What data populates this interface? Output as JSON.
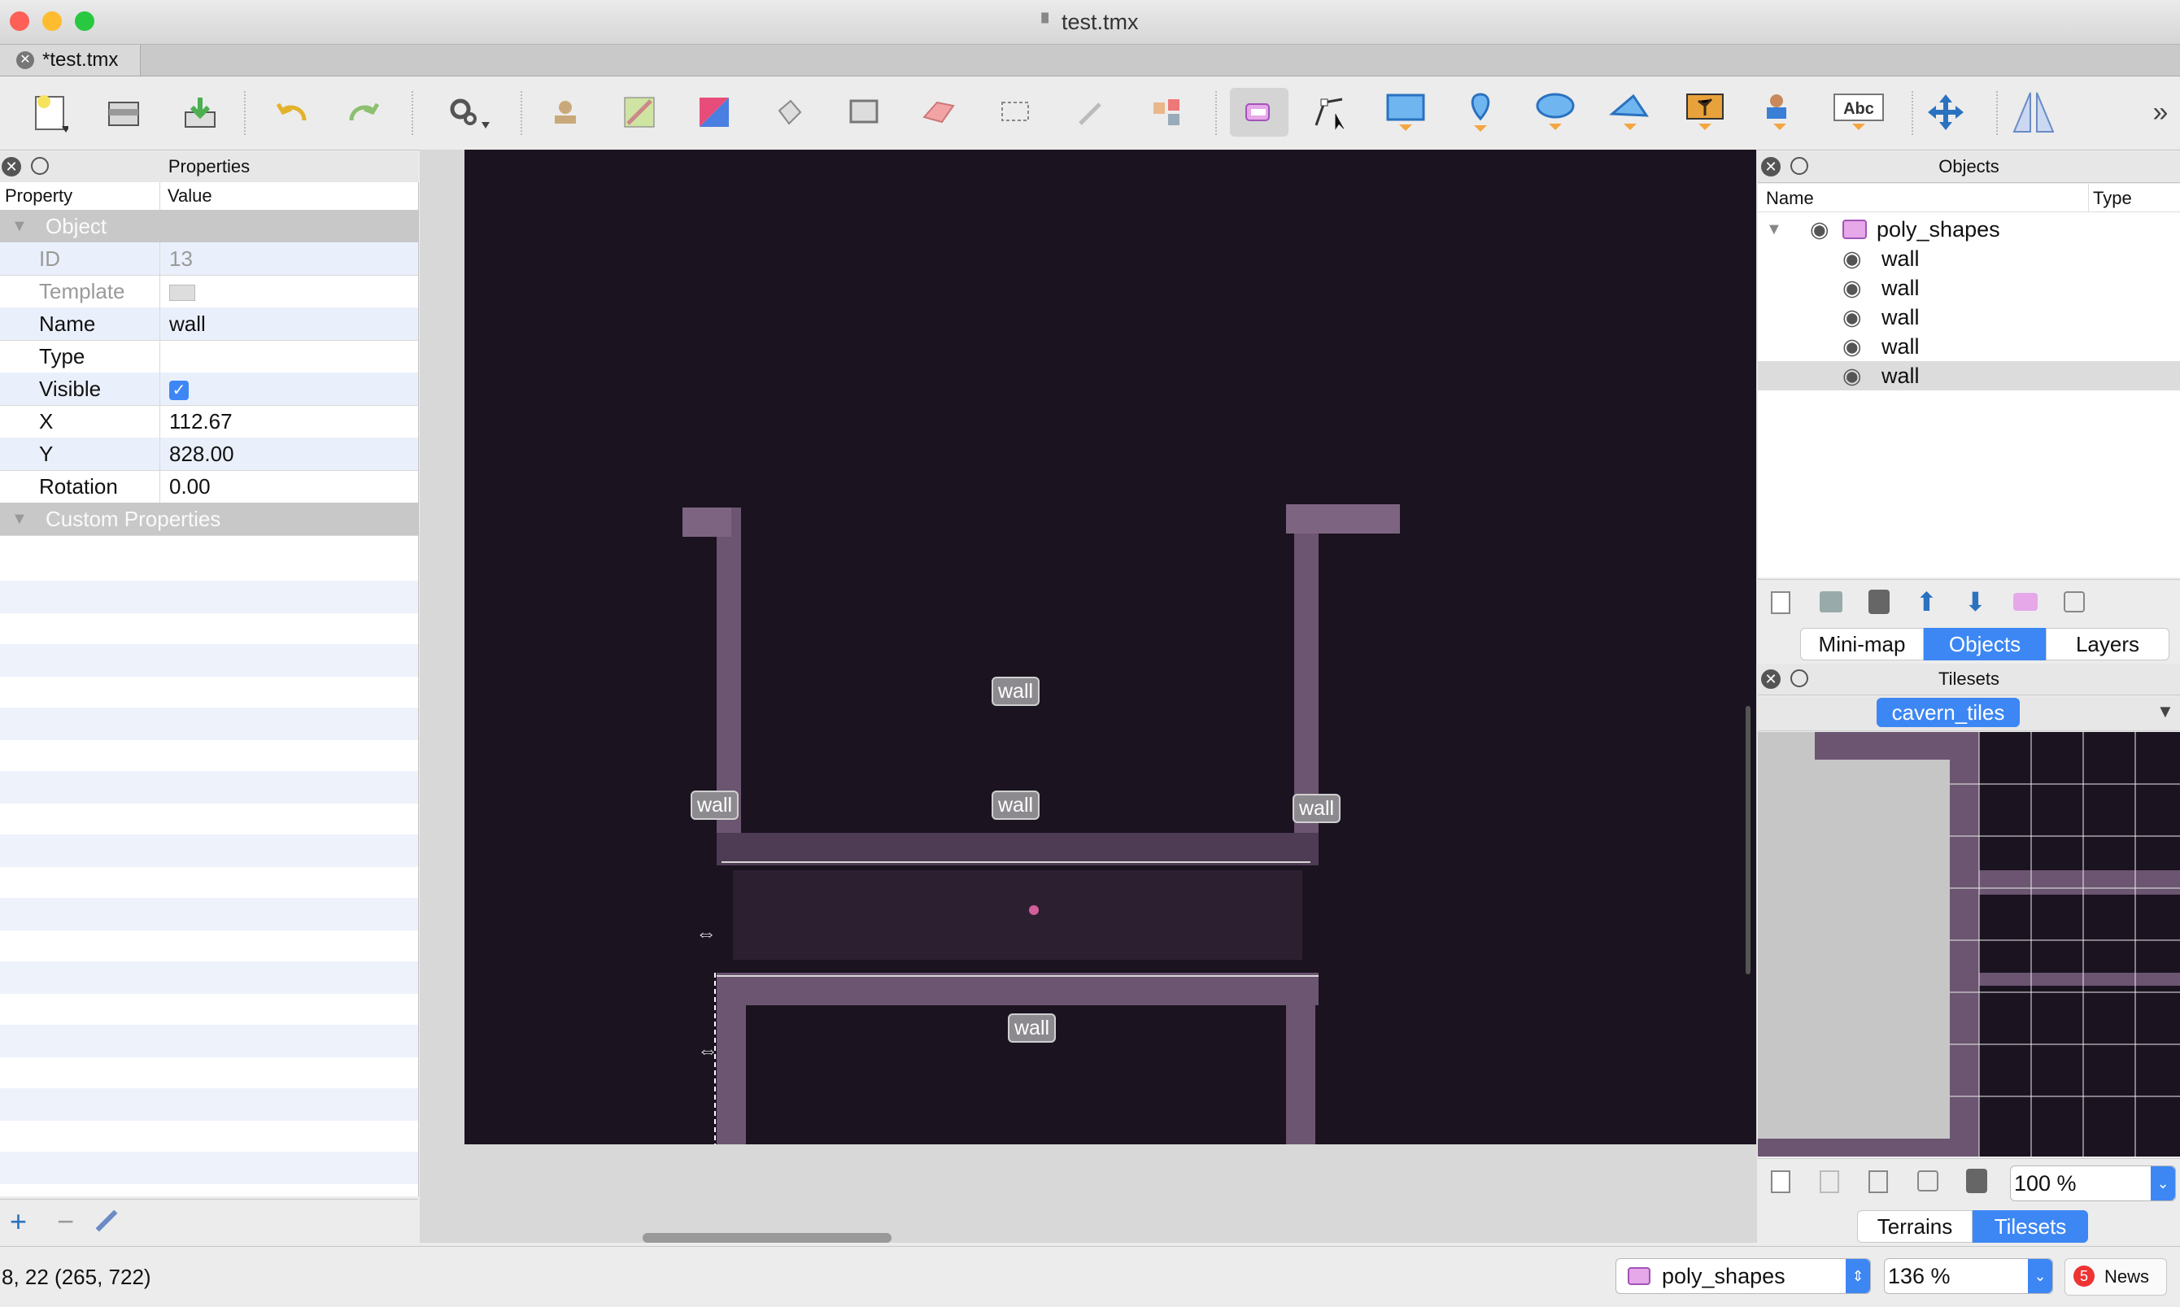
{
  "window": {
    "title": "test.tmx",
    "tab_label": "*test.tmx"
  },
  "properties_panel": {
    "title": "Properties",
    "col_property": "Property",
    "col_value": "Value",
    "group_object": "Object",
    "rows": [
      {
        "key": "ID",
        "value": "13"
      },
      {
        "key": "Template",
        "value": ""
      },
      {
        "key": "Name",
        "value": "wall"
      },
      {
        "key": "Type",
        "value": ""
      },
      {
        "key": "Visible",
        "value": ""
      },
      {
        "key": "X",
        "value": "112.67"
      },
      {
        "key": "Y",
        "value": "828.00"
      },
      {
        "key": "Rotation",
        "value": "0.00"
      }
    ],
    "group_custom": "Custom Properties"
  },
  "canvas": {
    "labels": [
      "wall",
      "wall",
      "wall",
      "wall",
      "wall"
    ]
  },
  "objects_panel": {
    "title": "Objects",
    "col_name": "Name",
    "col_type": "Type",
    "layer": "poly_shapes",
    "items": [
      "wall",
      "wall",
      "wall",
      "wall",
      "wall"
    ],
    "tabs": [
      "Mini-map",
      "Objects",
      "Layers"
    ],
    "selected_tab": "Objects"
  },
  "tilesets_panel": {
    "title": "Tilesets",
    "tileset": "cavern_tiles",
    "zoom": "100 %",
    "tabs": [
      "Terrains",
      "Tilesets"
    ],
    "selected_tab": "Tilesets"
  },
  "status": {
    "coords": "8, 22 (265, 722)",
    "layer_combo": "poly_shapes",
    "zoom_combo": "136 %",
    "news_count": "5",
    "news_label": "News"
  },
  "colors": {
    "accent": "#3d87f4",
    "map_bg": "#1b1320",
    "rock": "#6b5570"
  }
}
